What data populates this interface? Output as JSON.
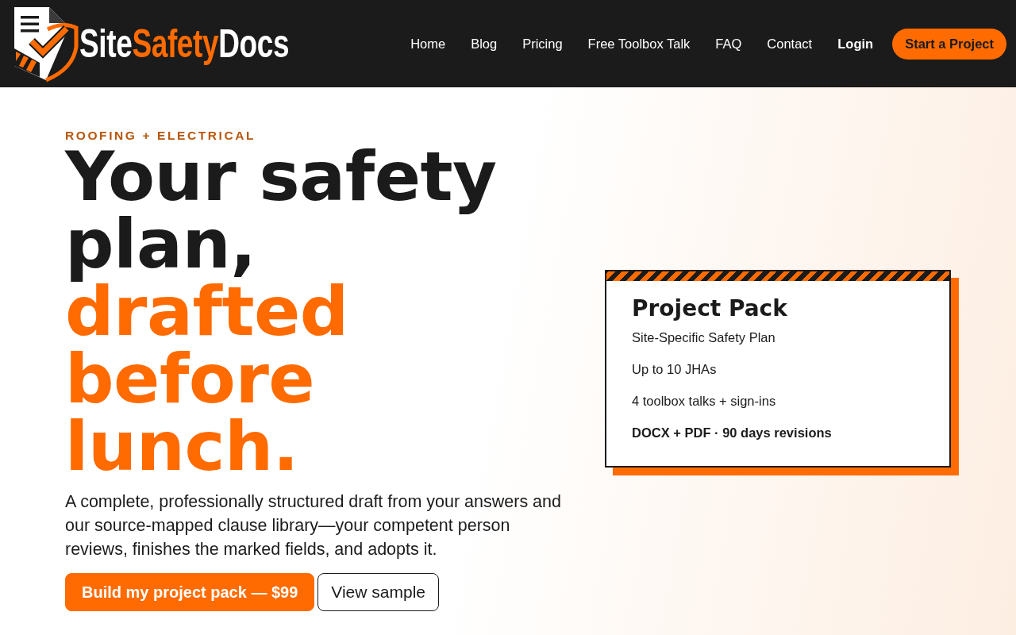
{
  "header": {
    "logo": {
      "parts": [
        {
          "text": "Site",
          "accent": false
        },
        {
          "text": "Safety",
          "accent": true
        },
        {
          "text": "Docs",
          "accent": false
        }
      ]
    },
    "nav": [
      {
        "label": "Home",
        "emphasized": false
      },
      {
        "label": "Blog",
        "emphasized": false
      },
      {
        "label": "Pricing",
        "emphasized": false
      },
      {
        "label": "Free Toolbox Talk",
        "emphasized": false
      },
      {
        "label": "FAQ",
        "emphasized": false
      },
      {
        "label": "Contact",
        "emphasized": false
      },
      {
        "label": "Login",
        "emphasized": true
      }
    ],
    "cta": "Start a Project"
  },
  "hero": {
    "kicker": "ROOFING + ELECTRICAL",
    "headline": [
      {
        "text": "Your safety plan,",
        "accent": false
      },
      {
        "text": "drafted before lunch.",
        "accent": true
      }
    ],
    "description": "A complete, professionally structured draft from your answers and our source-mapped clause library—your competent person reviews, finishes the marked fields, and adopts it.",
    "buttons": [
      {
        "label": "Build my project pack — $99",
        "kind": "primary"
      },
      {
        "label": "View sample",
        "kind": "secondary"
      }
    ]
  },
  "card": {
    "title": "Project Pack",
    "items": [
      {
        "text": "Site-Specific Safety Plan",
        "emphasized": false
      },
      {
        "text": "Up to 10 JHAs",
        "emphasized": false
      },
      {
        "text": "4 toolbox talks + sign-ins",
        "emphasized": false
      },
      {
        "text": "DOCX + PDF · 90 days revisions",
        "emphasized": true
      }
    ]
  }
}
